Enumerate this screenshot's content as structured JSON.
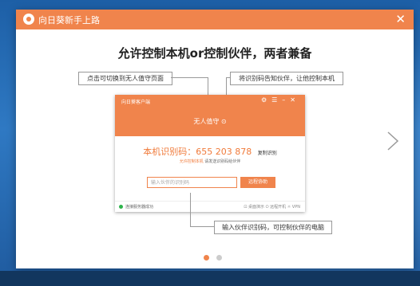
{
  "window": {
    "title": "向日葵新手上路",
    "close_icon": "close-icon"
  },
  "slide": {
    "headline": "允许控制本机or控制伙伴，两者兼备",
    "callouts": {
      "top_left": "点击可切换到无人值守页面",
      "top_right": "将识别码告知伙伴，让他控制本机",
      "bottom": "输入伙伴识别码，可控制伙伴的电脑"
    },
    "next_icon": "chevron-right-icon",
    "pagination": {
      "current": 1,
      "total": 2
    }
  },
  "app": {
    "title": "向日葵客户端",
    "mode": "无人值守",
    "id_label": "本机识别码：655 203 878",
    "copy": "复制识别",
    "desc_prefix": "允许控制本机",
    "desc_rest": "请发送识别码给伙伴",
    "input_placeholder": "输入伙伴的识别码",
    "connect": "远程协助",
    "status": "连接服务器成功",
    "footer": "⊡ 桌面演示 ⏻ 远程开机 ☼ VPN"
  },
  "colors": {
    "accent": "#f0844c",
    "status_ok": "#2db34a"
  }
}
